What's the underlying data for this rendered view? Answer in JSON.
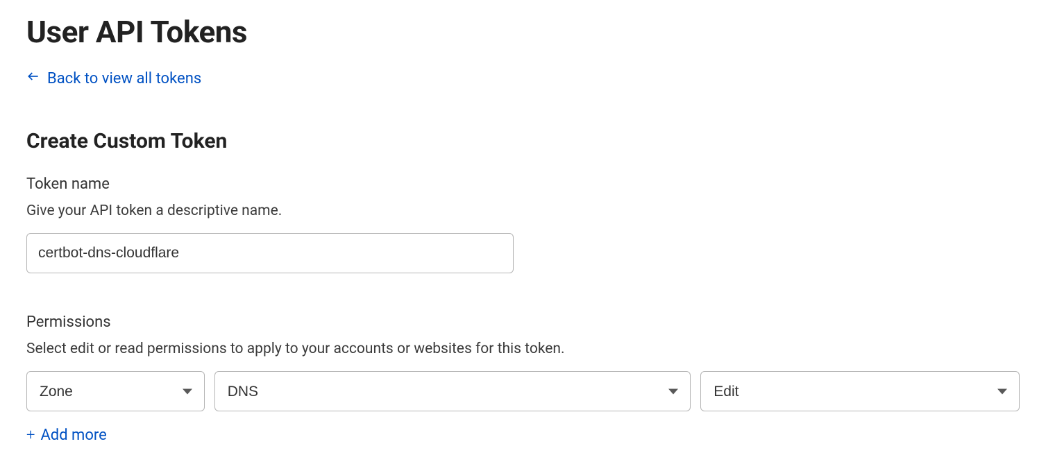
{
  "colors": {
    "link": "#0051c3",
    "text": "#222222",
    "border": "#b5b5b5"
  },
  "header": {
    "page_title": "User API Tokens",
    "back_link_label": "Back to view all tokens"
  },
  "form": {
    "section_title": "Create Custom Token",
    "token_name": {
      "label": "Token name",
      "description": "Give your API token a descriptive name.",
      "value": "certbot-dns-cloudflare"
    },
    "permissions": {
      "label": "Permissions",
      "description": "Select edit or read permissions to apply to your accounts or websites for this token.",
      "rows": [
        {
          "scope": "Zone",
          "resource": "DNS",
          "action": "Edit"
        }
      ],
      "add_more_label": "Add more"
    }
  }
}
